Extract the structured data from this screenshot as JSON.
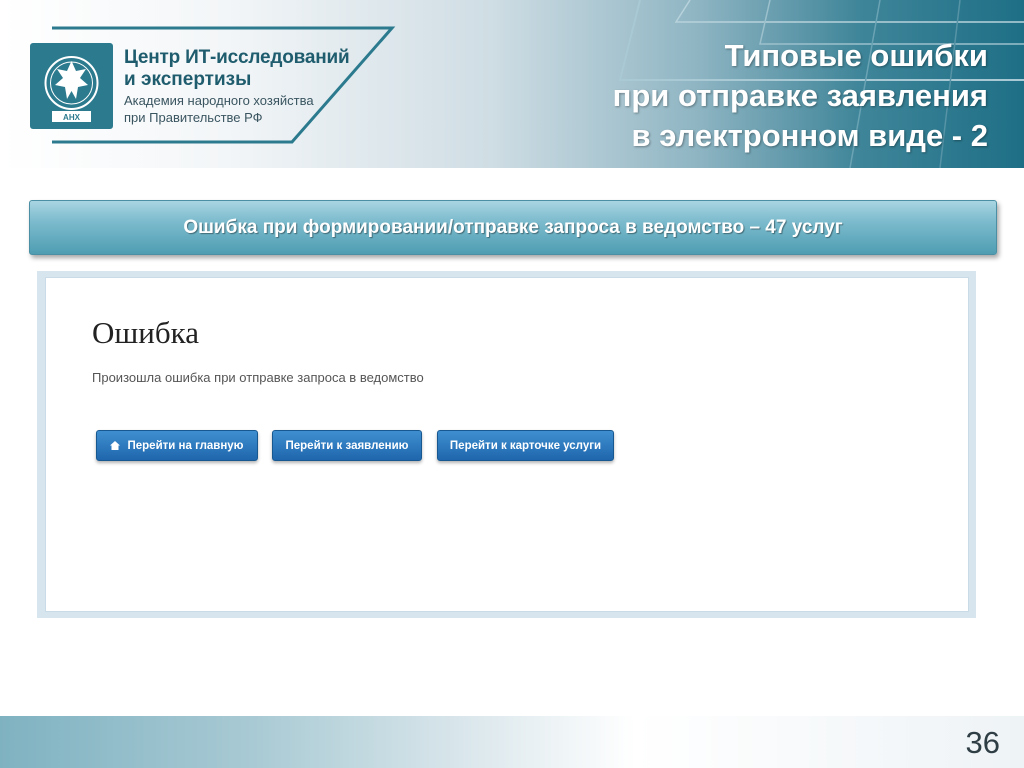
{
  "header": {
    "org_line1": "Центр ИТ-исследований",
    "org_line2": "и экспертизы",
    "org_line3": "Академия народного хозяйства",
    "org_line4": "при Правительстве РФ",
    "logo_text": "АНХ",
    "title_lines": [
      "Типовые ошибки",
      "при отправке заявления",
      "в электронном виде - 2"
    ]
  },
  "banner": {
    "text": "Ошибка при формировании/отправке запроса в ведомство – 47 услуг"
  },
  "screenshot": {
    "title": "Ошибка",
    "message": "Произошла ошибка при отправке запроса в ведомство",
    "buttons": {
      "home": "Перейти на главную",
      "application": "Перейти к заявлению",
      "service_card": "Перейти к карточке услуги"
    }
  },
  "footer": {
    "page_number": "36"
  },
  "colors": {
    "brand_teal": "#2b7a8e",
    "button_blue": "#1f66ad",
    "banner": "#7fbdcf"
  },
  "icons": [
    "emblem-icon",
    "home-icon"
  ]
}
